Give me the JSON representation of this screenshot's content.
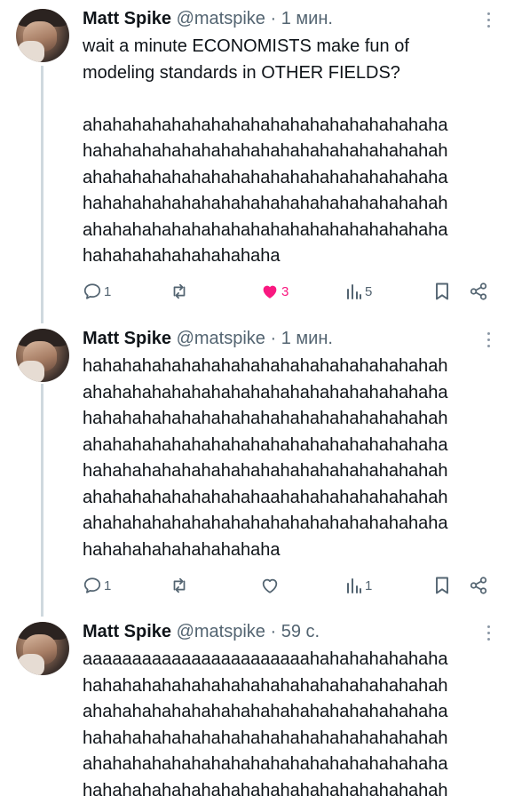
{
  "tweets": [
    {
      "name": "Matt Spike",
      "handle": "@matspike",
      "dot": "·",
      "time": "1 мин.",
      "text": "wait a minute ECONOMISTS make fun of\nmodeling standards in OTHER FIELDS?\n\nahahahahahahahahahahahahahahahahahaha\nhahahahahahahahahahahahahahahahahahah\nahahahahahahahahahahahahahahahahahaha\nhahahahahahahahahahahahahahahahahahah\nahahahahahahahahahahahahahahahahahaha\nhahahahahahahahahaha",
      "replies": "1",
      "reposts": "",
      "likes": "3",
      "liked": true,
      "views": "5"
    },
    {
      "name": "Matt Spike",
      "handle": "@matspike",
      "dot": "·",
      "time": "1 мин.",
      "text": "hahahahahahahahahahahahahahahahahahah\nahahahahahahahahahahahahahahahahahaha\nhahahahahahahahahahahahahahahahahahah\nahahahahahahahahahahahahahahahahahaha\nhahahahahahahahahahahahahahahahahahah\nahahahahahahahahahaahahahahahahahahah\nahahahahahahahahahahahahahahahahahaha\nhahahahahahahahahaha",
      "replies": "1",
      "reposts": "",
      "likes": "",
      "liked": false,
      "views": "1"
    },
    {
      "name": "Matt Spike",
      "handle": "@matspike",
      "dot": "·",
      "time": "59 с.",
      "text": "aaaaaaaaaaaaaaaaaaaaaaahahahahahahaha\nhahahahahahahahahahahahahahahahahahah\nahahahahahahahahahahahahahahahahahaha\nhahahahahahahahahahahahahahahahahahah\nahahahahahahahahahahahahahahahahahaha\nhahahahahahahahahahahahahahahahahahah"
    }
  ],
  "icons": {
    "reply": "reply-icon",
    "repost": "repost-icon",
    "like": "heart-icon",
    "views": "views-icon",
    "bookmark": "bookmark-icon",
    "share": "share-icon",
    "more": "more-icon"
  },
  "colors": {
    "text": "#0f1419",
    "muted": "#536471",
    "like": "#f91880",
    "thread_line": "#cfd9de"
  }
}
